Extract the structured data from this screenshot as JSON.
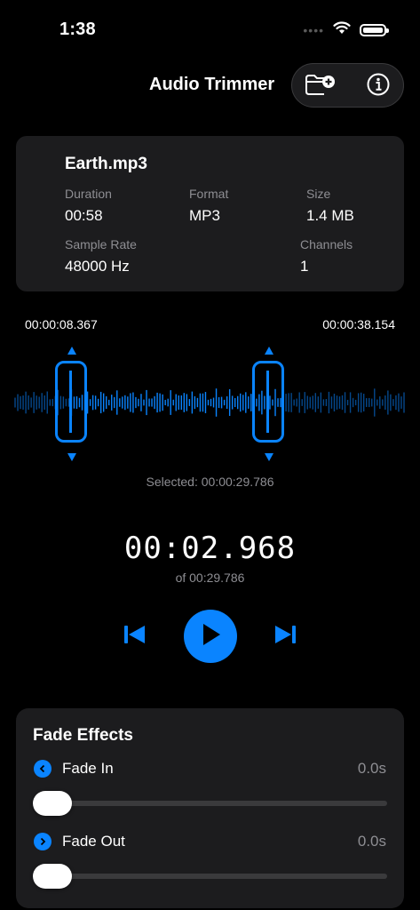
{
  "status_bar": {
    "time": "1:38",
    "dots": "••••"
  },
  "nav": {
    "title": "Audio Trimmer"
  },
  "file_info": {
    "name": "Earth.mp3",
    "duration_label": "Duration",
    "duration_value": "00:58",
    "format_label": "Format",
    "format_value": "MP3",
    "size_label": "Size",
    "size_value": "1.4 MB",
    "sample_rate_label": "Sample Rate",
    "sample_rate_value": "48000 Hz",
    "channels_label": "Channels",
    "channels_value": "1"
  },
  "trim": {
    "start_time": "00:00:08.367",
    "end_time": "00:00:38.154",
    "selected_text": "Selected: 00:00:29.786"
  },
  "playback": {
    "current_time": "00:02.968",
    "total_text": "of 00:29.786"
  },
  "fade": {
    "title": "Fade Effects",
    "fade_in_label": "Fade In",
    "fade_in_value": "0.0s",
    "fade_in_level": 0,
    "fade_out_label": "Fade Out",
    "fade_out_value": "0.0s",
    "fade_out_level": 0
  },
  "colors": {
    "accent": "#0a84ff",
    "background": "#000000",
    "card": "#1c1c1e",
    "secondary_text": "#8e8e93"
  }
}
